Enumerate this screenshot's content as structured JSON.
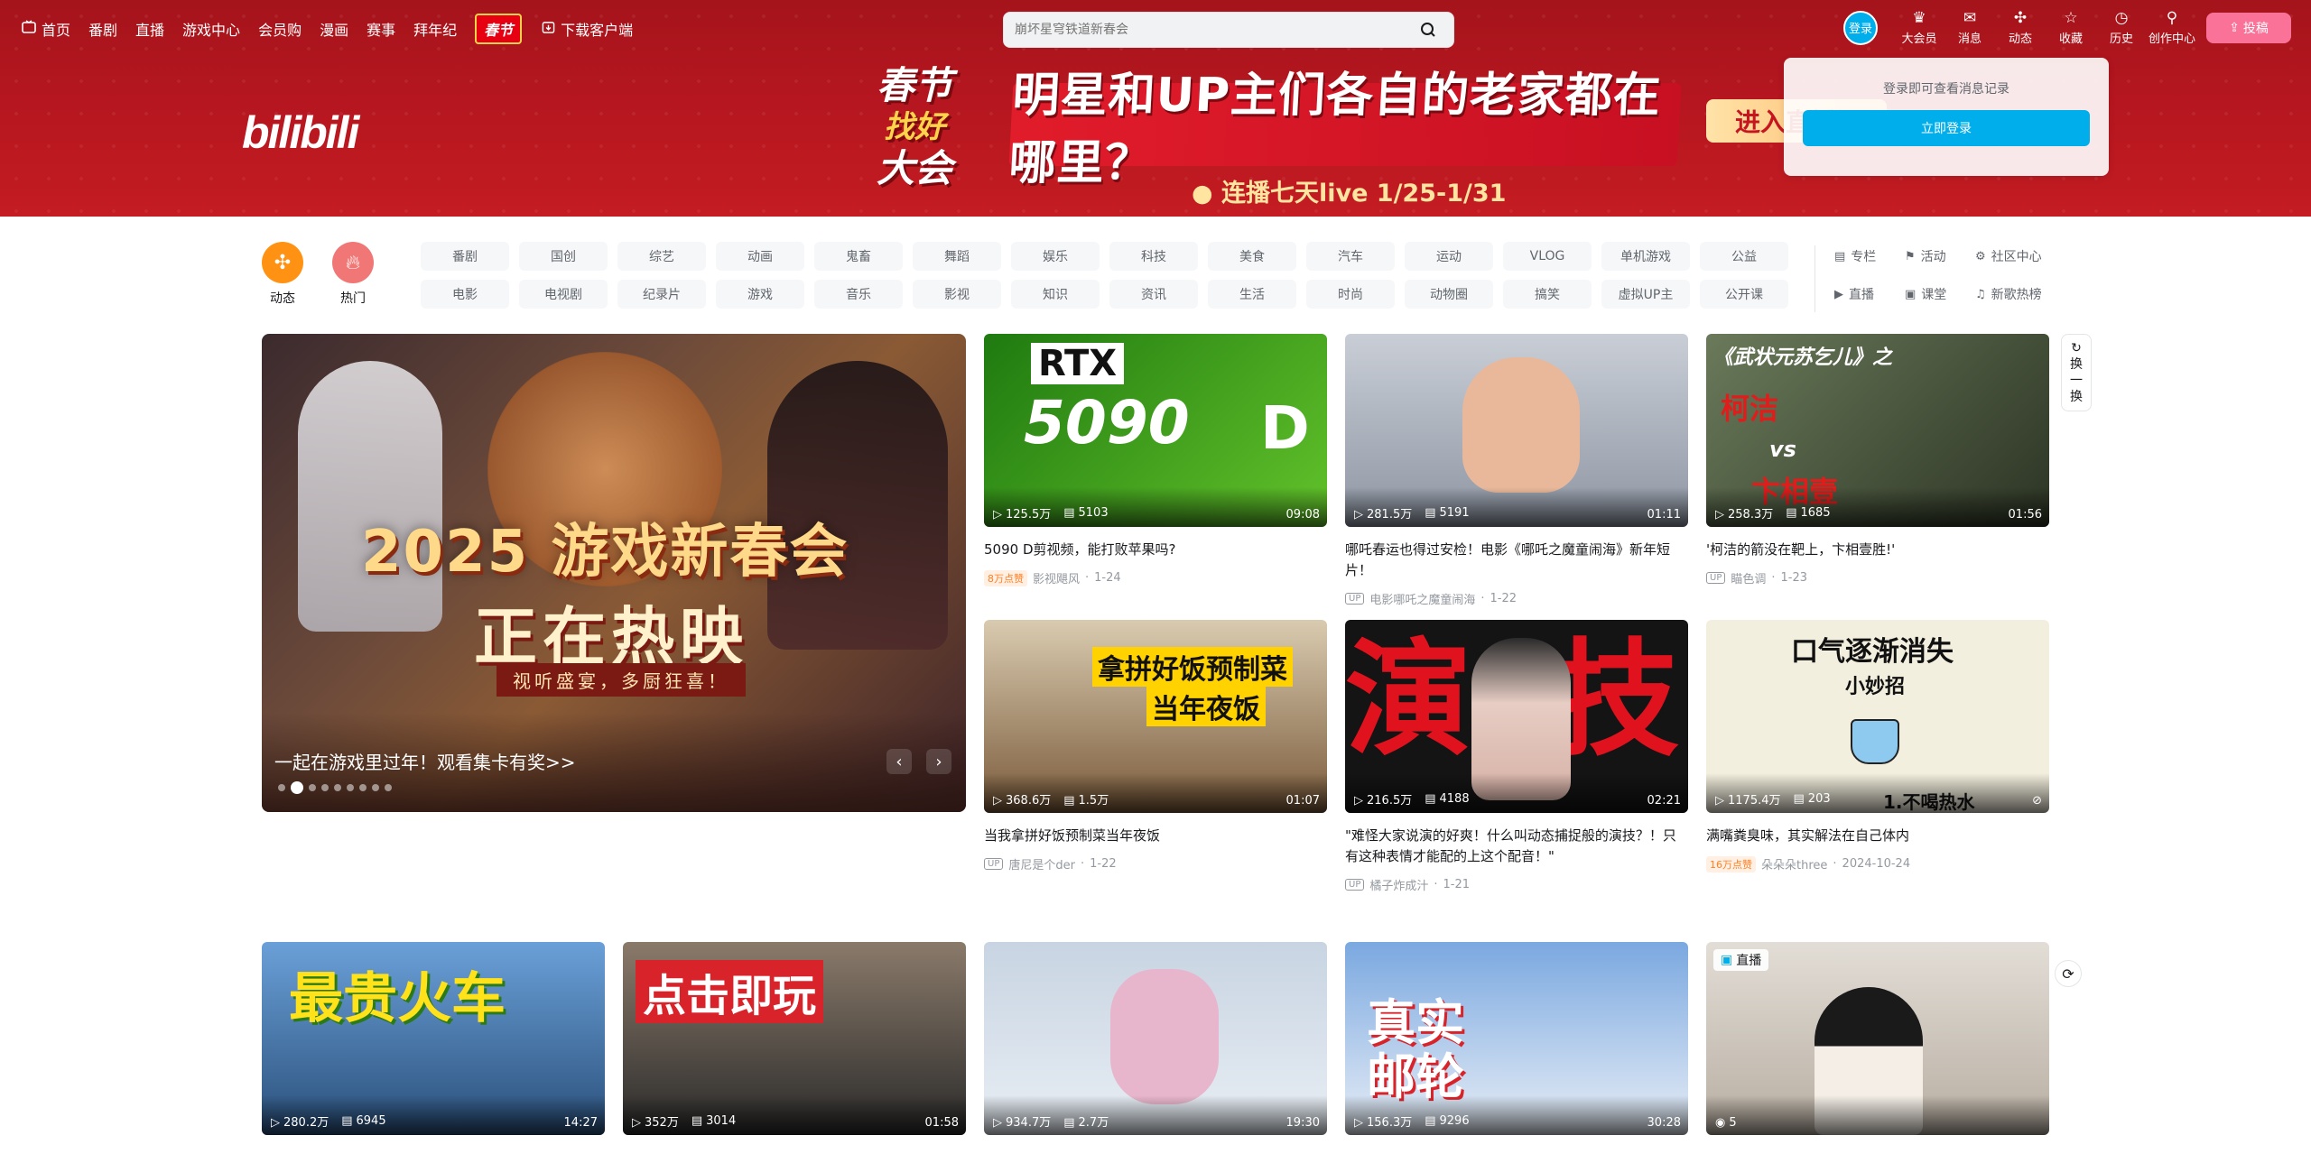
{
  "nav": {
    "left": [
      {
        "label": "首页",
        "icon": "tv-icon"
      },
      {
        "label": "番剧"
      },
      {
        "label": "直播"
      },
      {
        "label": "游戏中心"
      },
      {
        "label": "会员购"
      },
      {
        "label": "漫画"
      },
      {
        "label": "赛事"
      },
      {
        "label": "拜年纪"
      }
    ],
    "spring_badge": "春节",
    "download": "下载客户端",
    "search_placeholder": "崩坏星穹铁道新春会",
    "login_label": "登录",
    "right": [
      {
        "label": "大会员",
        "icon": "vip-icon"
      },
      {
        "label": "消息",
        "icon": "message-icon"
      },
      {
        "label": "动态",
        "icon": "feed-icon"
      },
      {
        "label": "收藏",
        "icon": "star-icon"
      },
      {
        "label": "历史",
        "icon": "clock-icon"
      },
      {
        "label": "创作中心",
        "icon": "lightbulb-icon"
      }
    ],
    "upload": "投稿"
  },
  "banner": {
    "logo": "bilibili",
    "mark_line1": "春节",
    "mark_line2": "找好",
    "mark_line3": "大会",
    "headline": "明星和UP主们各自的老家都在哪里？",
    "schedule": "● 连播七天live 1/25-1/31",
    "enter": "进入直播间",
    "colors": {
      "primary": "#b5161f",
      "accent": "#ffd34a"
    }
  },
  "login_popup": {
    "tip": "登录即可查看消息记录",
    "button": "立即登录"
  },
  "channels": {
    "dynamic": "动态",
    "hot": "热门",
    "tags": [
      "番剧",
      "国创",
      "综艺",
      "动画",
      "鬼畜",
      "舞蹈",
      "娱乐",
      "科技",
      "美食",
      "汽车",
      "运动",
      "VLOG",
      "单机游戏",
      "公益",
      "电影",
      "电视剧",
      "纪录片",
      "游戏",
      "音乐",
      "影视",
      "知识",
      "资讯",
      "生活",
      "时尚",
      "动物圈",
      "搞笑",
      "虚拟UP主",
      "公开课"
    ],
    "extras": [
      {
        "label": "专栏",
        "icon": "article-icon"
      },
      {
        "label": "活动",
        "icon": "flag-icon"
      },
      {
        "label": "社区中心",
        "icon": "community-icon"
      },
      {
        "label": "直播",
        "icon": "live-icon"
      },
      {
        "label": "课堂",
        "icon": "classroom-icon"
      },
      {
        "label": "新歌热榜",
        "icon": "music-chart-icon"
      }
    ],
    "colors": {
      "dynamic": "#ff9212",
      "hot": "#f07775"
    }
  },
  "carousel": {
    "headline": "2025 游戏新春会",
    "subline": "正在热映",
    "tagline": "视听盛宴，多厨狂喜！",
    "caption": "一起在游戏里过年！观看集卡有奖>>",
    "total_slides": 9,
    "active_slide": 2
  },
  "refresh": {
    "label_lines": [
      "换",
      "一",
      "换"
    ]
  },
  "videos": [
    {
      "views": "125.5万",
      "danmaku": "5103",
      "duration": "09:08",
      "title": "5090 D剪视频，能打败苹果吗?",
      "badge": "8万点赞",
      "author": "影视飓风",
      "date": "1-24",
      "thumb_text": "RTX 5090 D",
      "bg": "#2e8b14"
    },
    {
      "views": "281.5万",
      "danmaku": "5191",
      "duration": "01:11",
      "title": "哪吒春运也得过安检！电影《哪吒之魔童闹海》新年短片！",
      "badge": "",
      "author": "电影哪吒之魔童闹海",
      "date": "1-22",
      "thumb_text": "",
      "bg": "#9aa2ad"
    },
    {
      "views": "258.3万",
      "danmaku": "1685",
      "duration": "01:56",
      "title": "'柯洁的箭没在靶上，卞相壹胜!'",
      "badge": "",
      "author": "瞄色调",
      "date": "1-23",
      "thumb_text": "《武状元苏乞儿》之 柯洁 vs 卞相壹",
      "bg": "#4a5a3a"
    },
    {
      "views": "368.6万",
      "danmaku": "1.5万",
      "duration": "01:07",
      "title": "当我拿拼好饭预制菜当年夜饭",
      "badge": "",
      "author": "唐尼是个der",
      "date": "1-22",
      "thumb_text": "拿拼好饭预制菜 当年夜饭",
      "bg": "#7a5a3a"
    },
    {
      "views": "216.5万",
      "danmaku": "4188",
      "duration": "02:21",
      "title": "\"难怪大家说演的好爽！什么叫动态捕捉般的演技？！只有这种表情才能配的上这个配音！\"",
      "badge": "",
      "author": "橘子炸成汁",
      "date": "1-21",
      "thumb_text": "演技",
      "bg": "#1a1a1a"
    },
    {
      "views": "1175.4万",
      "danmaku": "203",
      "duration": "",
      "title": "满嘴粪臭味，其实解法在自己体内",
      "badge": "16万点赞",
      "author": "朵朵朵three",
      "date": "2024-10-24",
      "thumb_text": "口气逐渐消失 小妙招 1.不喝热水",
      "bg": "#f3efde"
    },
    {
      "views": "280.2万",
      "danmaku": "6945",
      "duration": "14:27",
      "title": "",
      "thumb_text": "最贵火车",
      "bg": "#4a8ac4"
    },
    {
      "views": "352万",
      "danmaku": "3014",
      "duration": "01:58",
      "title": "",
      "thumb_text": "点击即玩",
      "bg": "#3a3a3a"
    },
    {
      "views": "934.7万",
      "danmaku": "2.7万",
      "duration": "19:30",
      "title": "",
      "thumb_text": "",
      "bg": "#b7c4d4"
    },
    {
      "views": "156.3万",
      "danmaku": "9296",
      "duration": "30:28",
      "title": "",
      "thumb_text": "真实 邮轮",
      "bg": "#6a9ad4"
    },
    {
      "views": "5",
      "danmaku": "",
      "duration": "",
      "title": "",
      "thumb_text": "",
      "live_label": "直播",
      "bg": "#d7d0c8"
    }
  ]
}
